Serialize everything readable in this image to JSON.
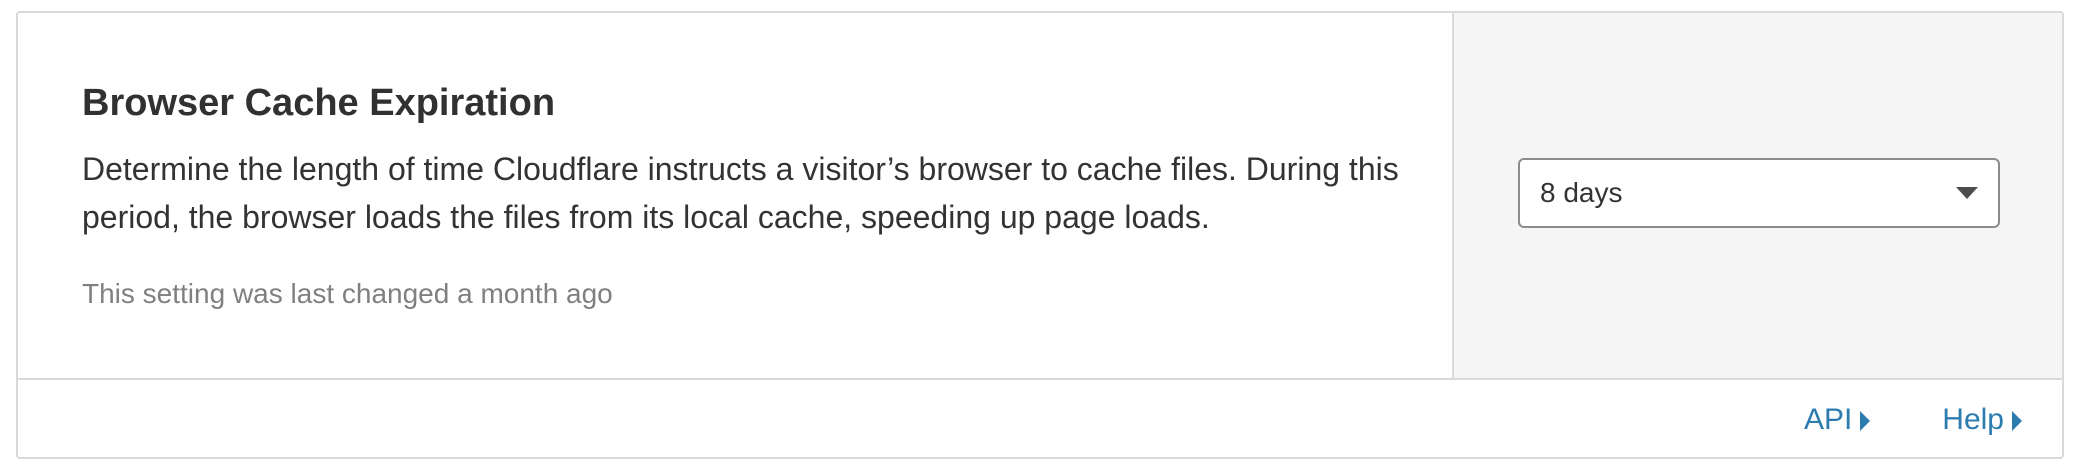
{
  "setting": {
    "title": "Browser Cache Expiration",
    "description": "Determine the length of time Cloudflare instructs a visitor’s browser to cache files. During this period, the browser loads the files from its local cache, speeding up page loads.",
    "last_changed": "This setting was last changed a month ago"
  },
  "control": {
    "selected_value": "8 days",
    "caret_icon": "chevron-down-icon"
  },
  "footer": {
    "links": [
      {
        "label": "API",
        "icon": "caret-right-icon"
      },
      {
        "label": "Help",
        "icon": "caret-right-icon"
      }
    ]
  },
  "colors": {
    "link": "#2c7cb0",
    "side_panel_bg": "#f5f5f5",
    "border": "#d9d9d9"
  }
}
